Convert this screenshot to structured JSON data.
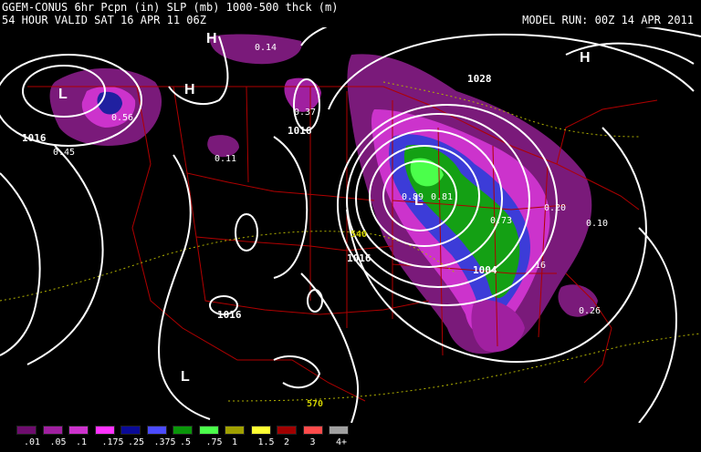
{
  "header": {
    "line1": "GGEM-CONUS 6hr Pcpn (in) SLP (mb) 1000-500 thck (m)",
    "line2": "54 HOUR VALID SAT 16 APR 11 06Z",
    "model_run": "MODEL RUN: 00Z 14 APR 2011"
  },
  "map": {
    "pressure_centers": {
      "high_1": "H",
      "high_2": "H",
      "high_3": "H",
      "low_1": "L",
      "low_2": "L",
      "low_3": "L"
    },
    "isobar_labels": {
      "p1028": "1028",
      "p1016_a": "1016",
      "p1016_b": "1016",
      "p1016_c": "1016",
      "p1016_d": "1016",
      "p1004": "1004"
    },
    "thickness_labels": {
      "t540": "540",
      "t570": "570"
    },
    "precip_max_labels": {
      "v014": "0.14",
      "v056": "0.56",
      "v045": "0.45",
      "v037": "0.37",
      "v011": "0.11",
      "v089": "0.89",
      "v081": "0.81",
      "v073": "0.73",
      "v020": "0.20",
      "v010": "0.10",
      "v16": "16",
      "v026": "0.26"
    }
  },
  "legend": {
    "items": [
      {
        "label": ".01",
        "color": "#6e0d6e"
      },
      {
        "label": ".05",
        "color": "#a020a0"
      },
      {
        "label": ".1",
        "color": "#cc33cc"
      },
      {
        "label": ".175",
        "color": "#ff33ff"
      },
      {
        "label": ".25",
        "color": "#0a0a96"
      },
      {
        "label": ".375",
        "color": "#4b4bff"
      },
      {
        "label": ".5",
        "color": "#0a960a"
      },
      {
        "label": ".75",
        "color": "#4bff4b"
      },
      {
        "label": "1",
        "color": "#a0a000"
      },
      {
        "label": "1.5",
        "color": "#ffff33"
      },
      {
        "label": "2",
        "color": "#a00000"
      },
      {
        "label": "3",
        "color": "#ff4b4b"
      },
      {
        "label": "4+",
        "color": "#a0a0a0"
      }
    ]
  },
  "colors": {
    "background": "#000000",
    "isobar": "#ffffff",
    "borders": "#b00000",
    "thickness": "#b0b000"
  }
}
